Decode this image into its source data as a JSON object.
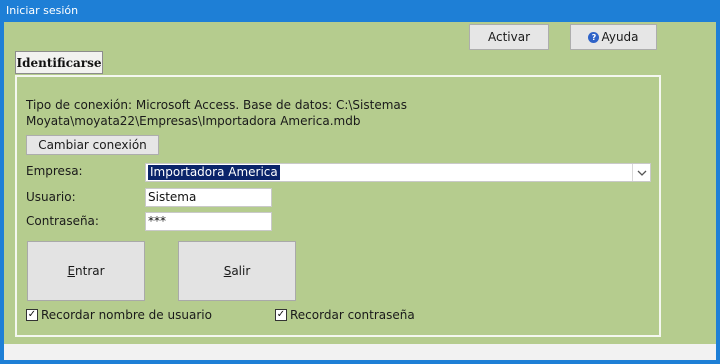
{
  "window": {
    "title": "Iniciar sesión"
  },
  "toolbar": {
    "activar_label": "Activar",
    "ayuda_label": "Ayuda"
  },
  "tab": {
    "label": "Identificarse"
  },
  "connection": {
    "text": "Tipo de conexión: Microsoft Access. Base de datos: C:\\Sistemas Moyata\\moyata22\\Empresas\\Importadora America.mdb",
    "change_label": "Cambiar conexión"
  },
  "form": {
    "empresa_label": "Empresa:",
    "empresa_value": "Importadora America",
    "usuario_label": "Usuario:",
    "usuario_value": "Sistema",
    "password_label": "Contraseña:",
    "password_value": "***"
  },
  "actions": {
    "entrar_first": "E",
    "entrar_rest": "ntrar",
    "salir_first": "S",
    "salir_rest": "alir"
  },
  "options": {
    "remember_user_label": "Recordar nombre de usuario",
    "remember_user_checked": true,
    "remember_password_label": "Recordar contraseña",
    "remember_password_checked": true
  },
  "colors": {
    "titlebar": "#1e7fd6",
    "client": "#b5cc8e",
    "selection": "#0a246a"
  },
  "icons": {
    "help": "help-icon",
    "dropdown": "chevron-down-icon",
    "check": "checkmark-icon"
  }
}
